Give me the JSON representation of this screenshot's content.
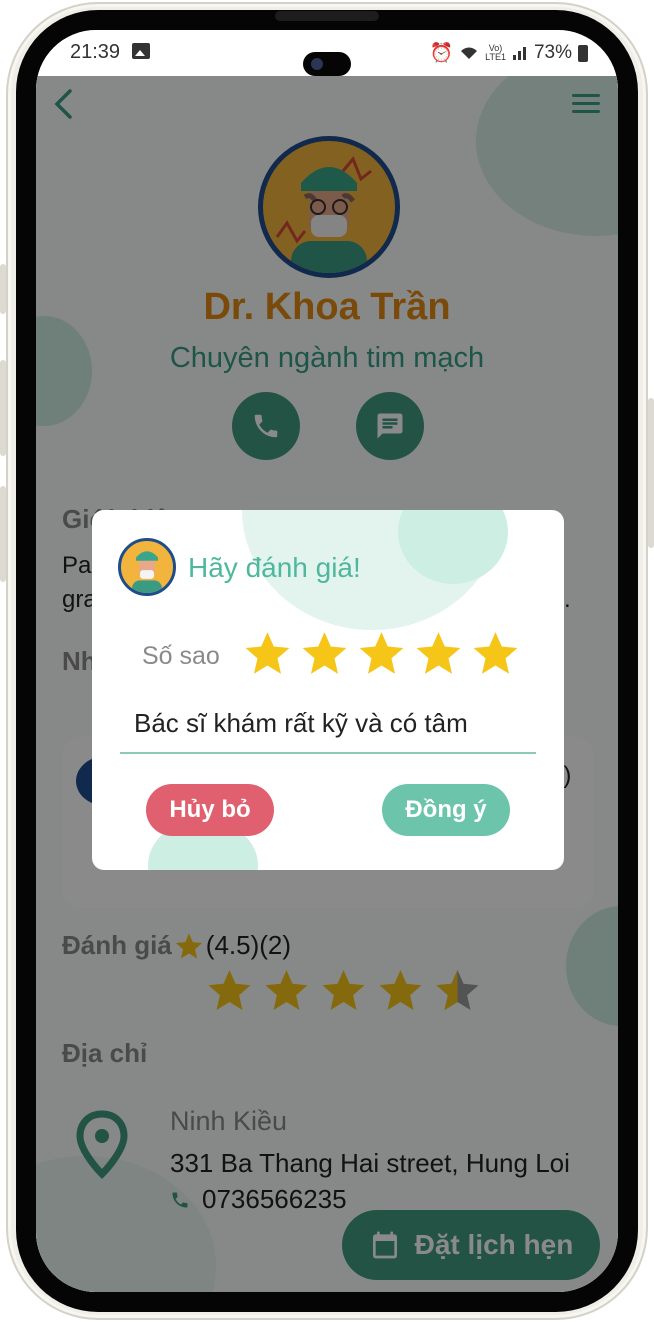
{
  "status_bar": {
    "time": "21:39",
    "network": "Vo))\nLTE1",
    "battery": "73%"
  },
  "doctor": {
    "name": "Dr. Khoa Trần",
    "specialty": "Chuyên ngành tim mạch"
  },
  "intro": {
    "label": "Giới thiệu",
    "text_line1": "Pa",
    "text_line2": "gra",
    "text_tail": "."
  },
  "reviews": {
    "label": "Nh",
    "tail": "5)"
  },
  "rating": {
    "label": "Đánh giá",
    "value": "(4.5)",
    "count": "(2)",
    "stars": 4.5
  },
  "address": {
    "label": "Địa chỉ",
    "city": "Ninh Kiều",
    "street": "331 Ba Thang Hai street, Hung Loi",
    "phone": "0736566235"
  },
  "book_button": "Đặt lịch hẹn",
  "dialog": {
    "title": "Hãy đánh giá!",
    "stars_label": "Số sao",
    "stars": 5,
    "comment": "Bác sĩ khám rất kỹ và có tâm",
    "cancel_label": "Hủy bỏ",
    "ok_label": "Đồng ý"
  },
  "colors": {
    "primary": "#3f9a7f",
    "name": "#e08a14",
    "star": "#f5c518",
    "cancel": "#e06070",
    "ok": "#6cc5aa"
  }
}
